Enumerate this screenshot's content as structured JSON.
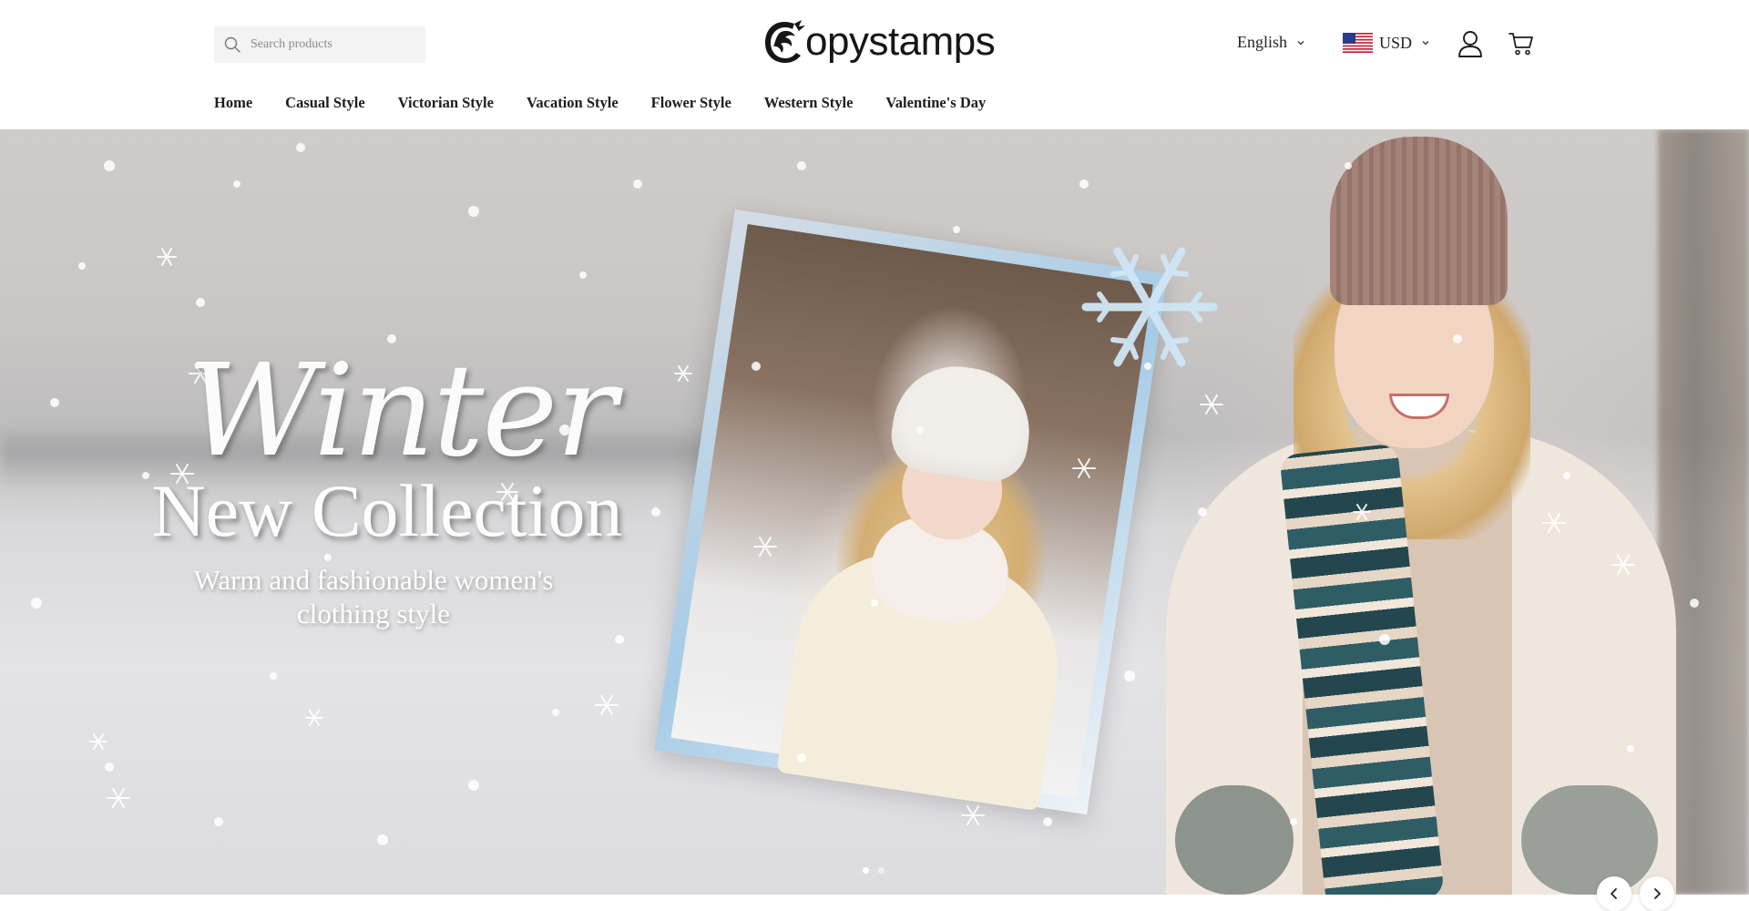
{
  "header": {
    "search_placeholder": "Search products",
    "logo_text": "opystamps",
    "language": "English",
    "currency": "USD"
  },
  "nav": {
    "items": [
      "Home",
      "Casual Style",
      "Victorian Style",
      "Vacation Style",
      "Flower Style",
      "Western Style",
      "Valentine's Day"
    ]
  },
  "hero": {
    "title": "Winter",
    "subtitle": "New Collection",
    "tagline": "Warm and fashionable women's clothing style",
    "slide_count": 2,
    "active_slide": 1
  },
  "icons": {
    "search": "search-icon",
    "account": "account-icon",
    "cart": "cart-icon",
    "flag": "us-flag-icon",
    "prev": "chevron-left-icon",
    "next": "chevron-right-icon"
  },
  "colors": {
    "nav_text": "#1d1d1d",
    "search_bg": "#f3f3f3",
    "hero_text": "#ffffff"
  }
}
